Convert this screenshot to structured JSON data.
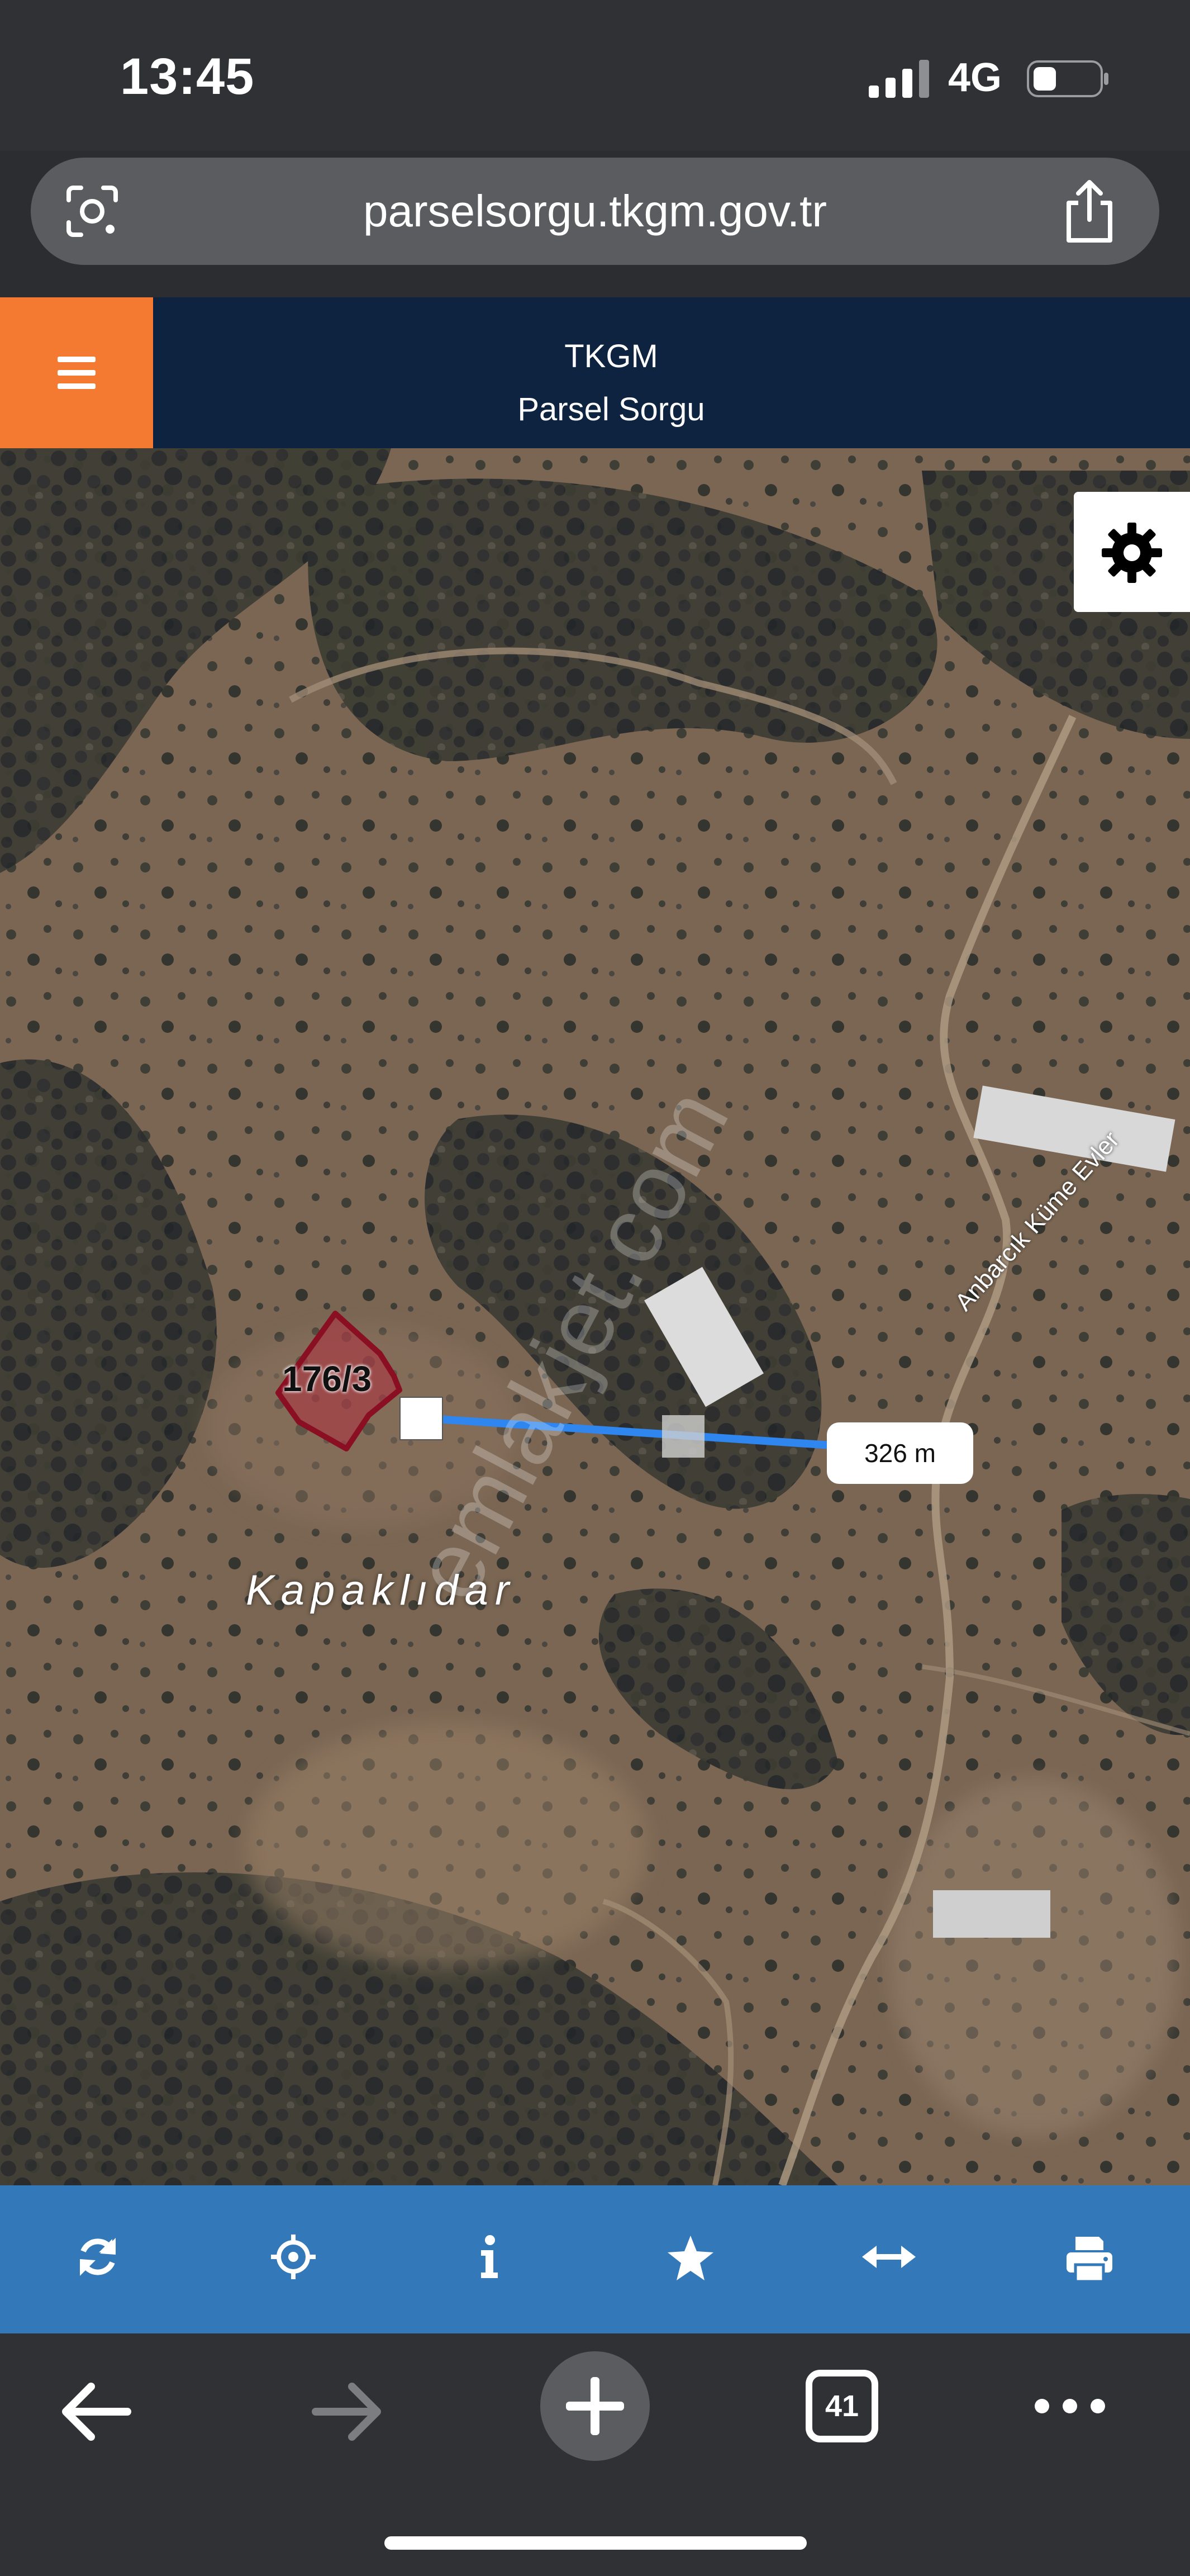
{
  "status_bar": {
    "time": "13:45",
    "network": "4G",
    "signal_icon": "cellular-signal-icon",
    "battery_icon": "battery-icon",
    "battery_level": 0.3
  },
  "browser": {
    "url": "parselsorgu.tkgm.gov.tr",
    "lens_icon": "camera-search-icon",
    "share_icon": "share-icon",
    "tabs_count": "41",
    "nav_icons": [
      "back-arrow-icon",
      "forward-arrow-icon",
      "new-tab-plus-icon",
      "tabs-icon",
      "more-icon"
    ]
  },
  "app_header": {
    "title": "TKGM",
    "subtitle": "Parsel Sorgu",
    "menu_icon": "hamburger-menu-icon"
  },
  "map": {
    "place_name": "Kapaklıdar",
    "road_name": "Anbarcık Küme Evler",
    "parcel_label": "176/3",
    "measurement": "326 m",
    "watermark": "emlakjet.com",
    "settings_icon": "gear-icon",
    "colors": {
      "parcel_fill": "#b03040",
      "parcel_border": "#8a0f22",
      "measure_line": "#2f86ef"
    }
  },
  "toolbar": {
    "icons": [
      "refresh-icon",
      "locate-icon",
      "info-icon",
      "favorite-star-icon",
      "measure-icon",
      "print-icon"
    ],
    "color": "#3378b8"
  }
}
